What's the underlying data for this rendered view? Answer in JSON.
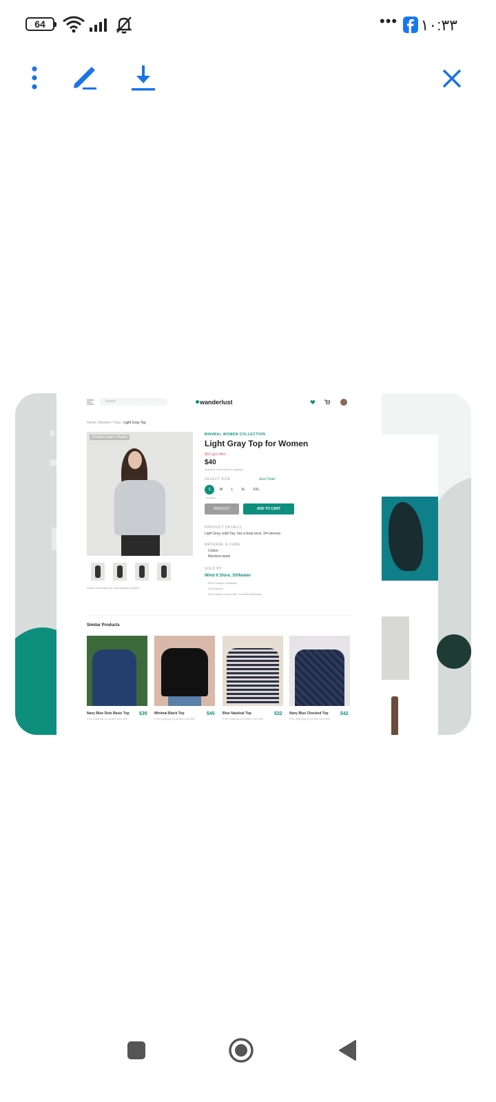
{
  "status_bar": {
    "battery_level": "64",
    "time": "١٠:٣٣",
    "icons": [
      "battery-icon",
      "wifi-icon",
      "signal-icon",
      "bell-muted-icon",
      "more-dots-icon",
      "facebook-icon"
    ]
  },
  "toolbar": {
    "icons": [
      "more-vertical-icon",
      "edit-pen-icon",
      "download-icon",
      "close-icon"
    ],
    "accent_color": "#1a73e8"
  },
  "preview": {
    "watermark_text": "Fashio",
    "search_placeholder": "Search",
    "logo": "wanderlust",
    "breadcrumb_prefix": "Home / Women / Tops /",
    "breadcrumb_current": "Light Gray Top",
    "image_badge": "Product under 1 Rated",
    "collection": "MINIMAL WOMEN COLLECTION",
    "title": "Light Gray Top for Women",
    "old_price": "$55 (get offer)",
    "price": "$40",
    "tax_note": "Inclusive of all taxes & shipping",
    "select_size_label": "SELECT SIZE",
    "size_chart": "Size Chart",
    "sizes": [
      "S",
      "M",
      "L",
      "XL",
      "XXL"
    ],
    "selected_size": "S",
    "size_note": "In stock",
    "wishlist_button": "WISHLIST",
    "add_to_cart_button": "ADD TO CART",
    "details_label": "PRODUCT DETAILS",
    "details_text": "Light Gray solid Top, has a boat neck, 3/4 sleeves",
    "material_label": "MATERIAL & CARE",
    "material_items": [
      "Cotton",
      "Machine-wash"
    ],
    "sold_by_label": "SOLD BY",
    "seller": "Wind It Store, Stillwater",
    "seller_items": [
      "95% Positive Feedback",
      "40 Products",
      "All Products comes with 3 months Warranty"
    ],
    "thumb_caption": "Prices and Insight for most popular product",
    "similar_title": "Similar Products",
    "similar_products": [
      {
        "name": "Navy Blue Dots Basic Top",
        "price": "$39",
        "sub": "Free shipping on orders over $50"
      },
      {
        "name": "Minimal Black Top",
        "price": "$45",
        "sub": "Free shipping on orders over $50"
      },
      {
        "name": "Blue Nautical Top",
        "price": "$32",
        "sub": "Free shipping on orders over $50"
      },
      {
        "name": "Navy Blue Checked Top",
        "price": "$42",
        "sub": "Free shipping on orders over $50"
      }
    ],
    "brand_color": "#0e8f7e"
  },
  "nav_bar": {
    "icons": [
      "recents-square-icon",
      "home-circle-icon",
      "back-triangle-icon"
    ]
  }
}
